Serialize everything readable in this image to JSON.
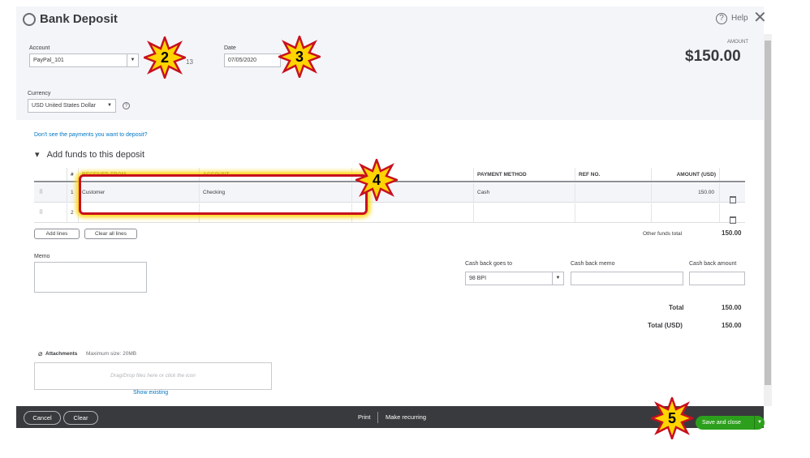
{
  "header": {
    "title": "Bank Deposit",
    "help_label": "Help",
    "amount_label": "AMOUNT",
    "amount_value": "$150.00"
  },
  "form": {
    "account_label": "Account",
    "account_value": "PayPal_101",
    "balance_partial": "13",
    "date_label": "Date",
    "date_value": "07/05/2020",
    "currency_label": "Currency",
    "currency_value": "USD United States Dollar"
  },
  "deposit": {
    "payments_link": "Don't see the payments you want to deposit?",
    "section_toggle": "▾",
    "section_title": "Add funds to this deposit",
    "columns": [
      "#",
      "RECEIVED FROM",
      "ACCOUNT",
      "",
      "PAYMENT METHOD",
      "REF NO.",
      "AMOUNT (USD)"
    ],
    "rows": [
      {
        "num": "1",
        "received_from": "Customer",
        "account": "Checking",
        "description": "",
        "payment_method": "Cash",
        "ref_no": "",
        "amount": "150.00"
      },
      {
        "num": "2",
        "received_from": "",
        "account": "",
        "description": "",
        "payment_method": "",
        "ref_no": "",
        "amount": ""
      }
    ],
    "add_lines": "Add lines",
    "clear_all_lines": "Clear all lines",
    "other_funds_label": "Other funds total",
    "other_funds_value": "150.00"
  },
  "memo": {
    "label": "Memo",
    "value": ""
  },
  "cashback": {
    "goes_to_label": "Cash back goes to",
    "goes_to_value": "98 BPI",
    "memo_label": "Cash back memo",
    "memo_value": "",
    "amount_label": "Cash back amount",
    "amount_value": ""
  },
  "totals": {
    "total_label": "Total",
    "total_value": "150.00",
    "total_usd_label": "Total (USD)",
    "total_usd_value": "150.00"
  },
  "attachments": {
    "label": "Attachments",
    "max_size": "Maximum size: 20MB",
    "dropzone": "Drag/Drop files here or click the icon",
    "show_existing": "Show existing"
  },
  "footer": {
    "cancel": "Cancel",
    "clear": "Clear",
    "print": "Print",
    "make_recurring": "Make recurring",
    "save_and_close": "Save and close"
  },
  "markers": [
    "2",
    "3",
    "4",
    "5"
  ],
  "colors": {
    "accent_green": "#2ca01c",
    "link_blue": "#0077c5",
    "footer_dark": "#393a3d",
    "marker_fill": "#ffd400",
    "marker_outline": "#c8101e"
  },
  "icons": {
    "title": "history-icon",
    "help": "help-circle-icon",
    "close": "close-icon",
    "info": "info-icon",
    "attach": "paperclip-icon",
    "delete": "trash-icon",
    "drag": "drag-handle-icon"
  }
}
